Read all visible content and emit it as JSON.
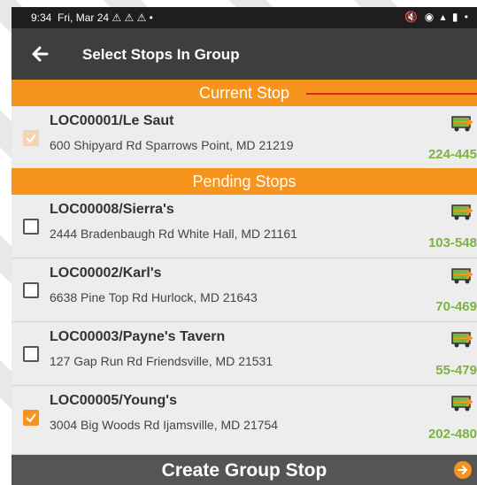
{
  "statusbar": {
    "time": "9:34",
    "date": "Fri, Mar 24"
  },
  "header": {
    "title": "Select Stops In Group"
  },
  "current_header": "Current Stop",
  "pending_header": "Pending Stops",
  "current_stop": {
    "name": "LOC00001/Le Saut",
    "address": "600 Shipyard Rd Sparrows Point, MD 21219",
    "number": "224-445",
    "checked": true
  },
  "pending_stops": [
    {
      "name": "LOC00008/Sierra's",
      "address": "2444 Bradenbaugh Rd White Hall, MD 21161",
      "number": "103-548",
      "checked": false
    },
    {
      "name": "LOC00002/Karl's",
      "address": "6638 Pine Top Rd Hurlock, MD 21643",
      "number": "70-469",
      "checked": false
    },
    {
      "name": "LOC00003/Payne's Tavern",
      "address": "127 Gap Run Rd Friendsville, MD 21531",
      "number": "55-479",
      "checked": false
    },
    {
      "name": "LOC00005/Young's",
      "address": "3004 Big Woods Rd Ijamsville, MD 21754",
      "number": "202-480",
      "checked": true
    }
  ],
  "footer": {
    "label": "Create Group Stop"
  },
  "colors": {
    "accent": "#f7941d",
    "green": "#7cb342",
    "appbar": "#3e3e3e"
  },
  "icons": {
    "back": "arrow-left-icon",
    "truck": "truck-icon",
    "go": "arrow-right-circle-icon"
  }
}
